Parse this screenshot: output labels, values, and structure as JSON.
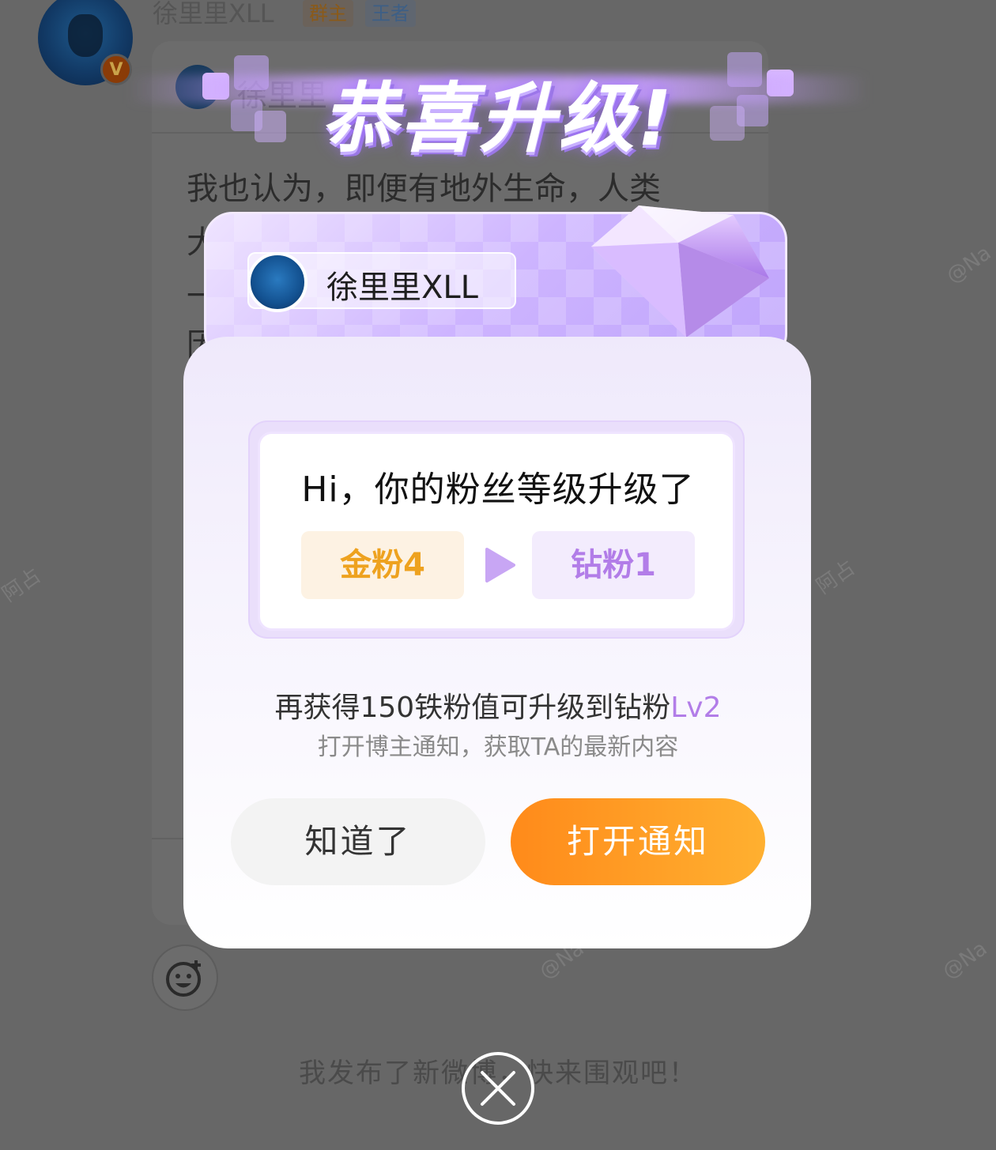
{
  "background": {
    "author_name": "徐里里XLL",
    "tags": [
      "群主",
      "王者"
    ],
    "quoted_name": "徐里里",
    "post_lines": [
      "我也认为，即便有地外生命，人类",
      "大",
      "一",
      "因"
    ],
    "bottom_text": "我发布了新微博，快来围观吧！",
    "verified_mark": "V"
  },
  "popup": {
    "title": "恭喜升级!",
    "user_name": "徐里里XLL",
    "message": "Hi，你的粉丝等级升级了",
    "level_from": "金粉4",
    "level_to": "钻粉1",
    "hint_prefix": "再获得150铁粉值可升级到钻粉",
    "hint_level": "Lv2",
    "hint_sub": "打开博主通知，获取TA的最新内容",
    "dismiss_label": "知道了",
    "open_label": "打开通知"
  },
  "colors": {
    "accent_orange": "#ff8a1a",
    "gold_level": "#eea21f",
    "purple_level": "#b27de8"
  },
  "icons": {
    "close": "close-icon",
    "sticker": "sticker-add-icon",
    "arrow": "play-arrow-icon",
    "gem": "diamond-icon"
  }
}
